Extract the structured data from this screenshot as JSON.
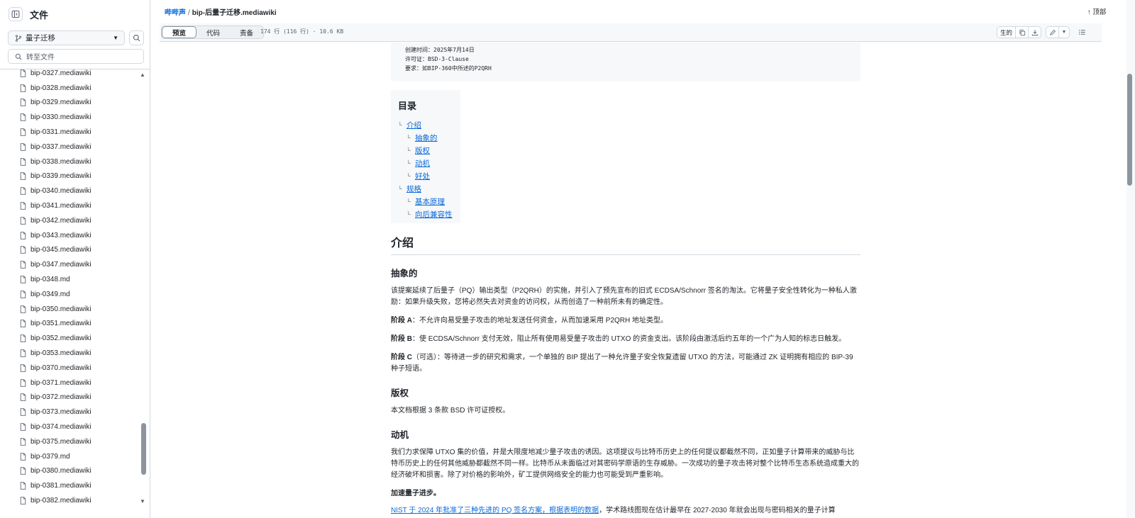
{
  "sidebar": {
    "title": "文件",
    "branch": "量子迁移",
    "goto_placeholder": "转至文件",
    "files": [
      "bip-0327.mediawiki",
      "bip-0328.mediawiki",
      "bip-0329.mediawiki",
      "bip-0330.mediawiki",
      "bip-0331.mediawiki",
      "bip-0337.mediawiki",
      "bip-0338.mediawiki",
      "bip-0339.mediawiki",
      "bip-0340.mediawiki",
      "bip-0341.mediawiki",
      "bip-0342.mediawiki",
      "bip-0343.mediawiki",
      "bip-0345.mediawiki",
      "bip-0347.mediawiki",
      "bip-0348.md",
      "bip-0349.md",
      "bip-0350.mediawiki",
      "bip-0351.mediawiki",
      "bip-0352.mediawiki",
      "bip-0353.mediawiki",
      "bip-0370.mediawiki",
      "bip-0371.mediawiki",
      "bip-0372.mediawiki",
      "bip-0373.mediawiki",
      "bip-0374.mediawiki",
      "bip-0375.mediawiki",
      "bip-0379.md",
      "bip-0380.mediawiki",
      "bip-0381.mediawiki",
      "bip-0382.mediawiki"
    ]
  },
  "header": {
    "repo": "哔哔声",
    "separator": "/",
    "filename": "bip-后量子迁移.mediawiki",
    "top_label": "顶部"
  },
  "toolbar": {
    "tabs": [
      "预览",
      "代码",
      "责备"
    ],
    "file_info": "174 行 (116 行) · 10.6 KB",
    "raw_label": "生的"
  },
  "meta": [
    "创建时间：2025年7月14日",
    "许可证：BSD-3-Clause",
    "要求：如BIP-360中所述的P2QRH"
  ],
  "toc": {
    "title": "目录",
    "items": [
      {
        "label": "介绍",
        "level": 1
      },
      {
        "label": "抽象的",
        "level": 2
      },
      {
        "label": "版权",
        "level": 2
      },
      {
        "label": "动机",
        "level": 2
      },
      {
        "label": "好处",
        "level": 2
      },
      {
        "label": "规格",
        "level": 1
      },
      {
        "label": "基本原理",
        "level": 2
      },
      {
        "label": "向后兼容性",
        "level": 2
      }
    ]
  },
  "body": {
    "intro_heading": "介绍",
    "abstract_heading": "抽象的",
    "abstract_text": "该提案延续了后量子（PQ）输出类型（P2QRH）的实施，并引入了预先宣布的旧式 ECDSA/Schnorr 签名的淘汰。它将量子安全性转化为一种私人激励：如果升级失败，您将必然失去对资金的访问权，从而创造了一种前所未有的确定性。",
    "phase_a_label": "阶段 A",
    "phase_a_text": "：不允许向易受量子攻击的地址发送任何资金，从而加速采用 P2QRH 地址类型。",
    "phase_b_label": "阶段 B",
    "phase_b_text": "：使 ECDSA/Schnorr 支付无效，阻止所有使用易受量子攻击的 UTXO 的资金支出。该阶段由激活后约五年的一个广为人知的标志日触发。",
    "phase_c_label": "阶段 C",
    "phase_c_text": "（可选）：等待进一步的研究和需求，一个单独的 BIP 提出了一种允许量子安全恢复遗留 UTXO 的方法，可能通过 ZK 证明拥有相应的 BIP-39 种子短语。",
    "copyright_heading": "版权",
    "copyright_text": "本文档根据 3 条款 BSD 许可证授权。",
    "motivation_heading": "动机",
    "motivation_text": "我们力求保障 UTXO 集的价值，并是大限度地减少量子攻击的诱因。这项提议与比特币历史上的任何提议都截然不同，正如量子计算带来的威胁与比特币历史上的任何其他威胁都截然不同一样。比特币从未面临过对其密码学原语的生存威胁。一次成功的量子攻击将对整个比特币生态系统造成重大的经济破坏和损害。除了对价格的影响外，矿工提供网络安全的能力也可能受到严重影响。",
    "accel_heading": "加速量子进步。",
    "accel_link": "NIST 于 2024 年批准了三种先进的 PQ 签名方案，根据表明的数据",
    "accel_text": "，学术路线图现在估计最早在 2027-2030 年就会出现与密码相关的量子计算"
  }
}
